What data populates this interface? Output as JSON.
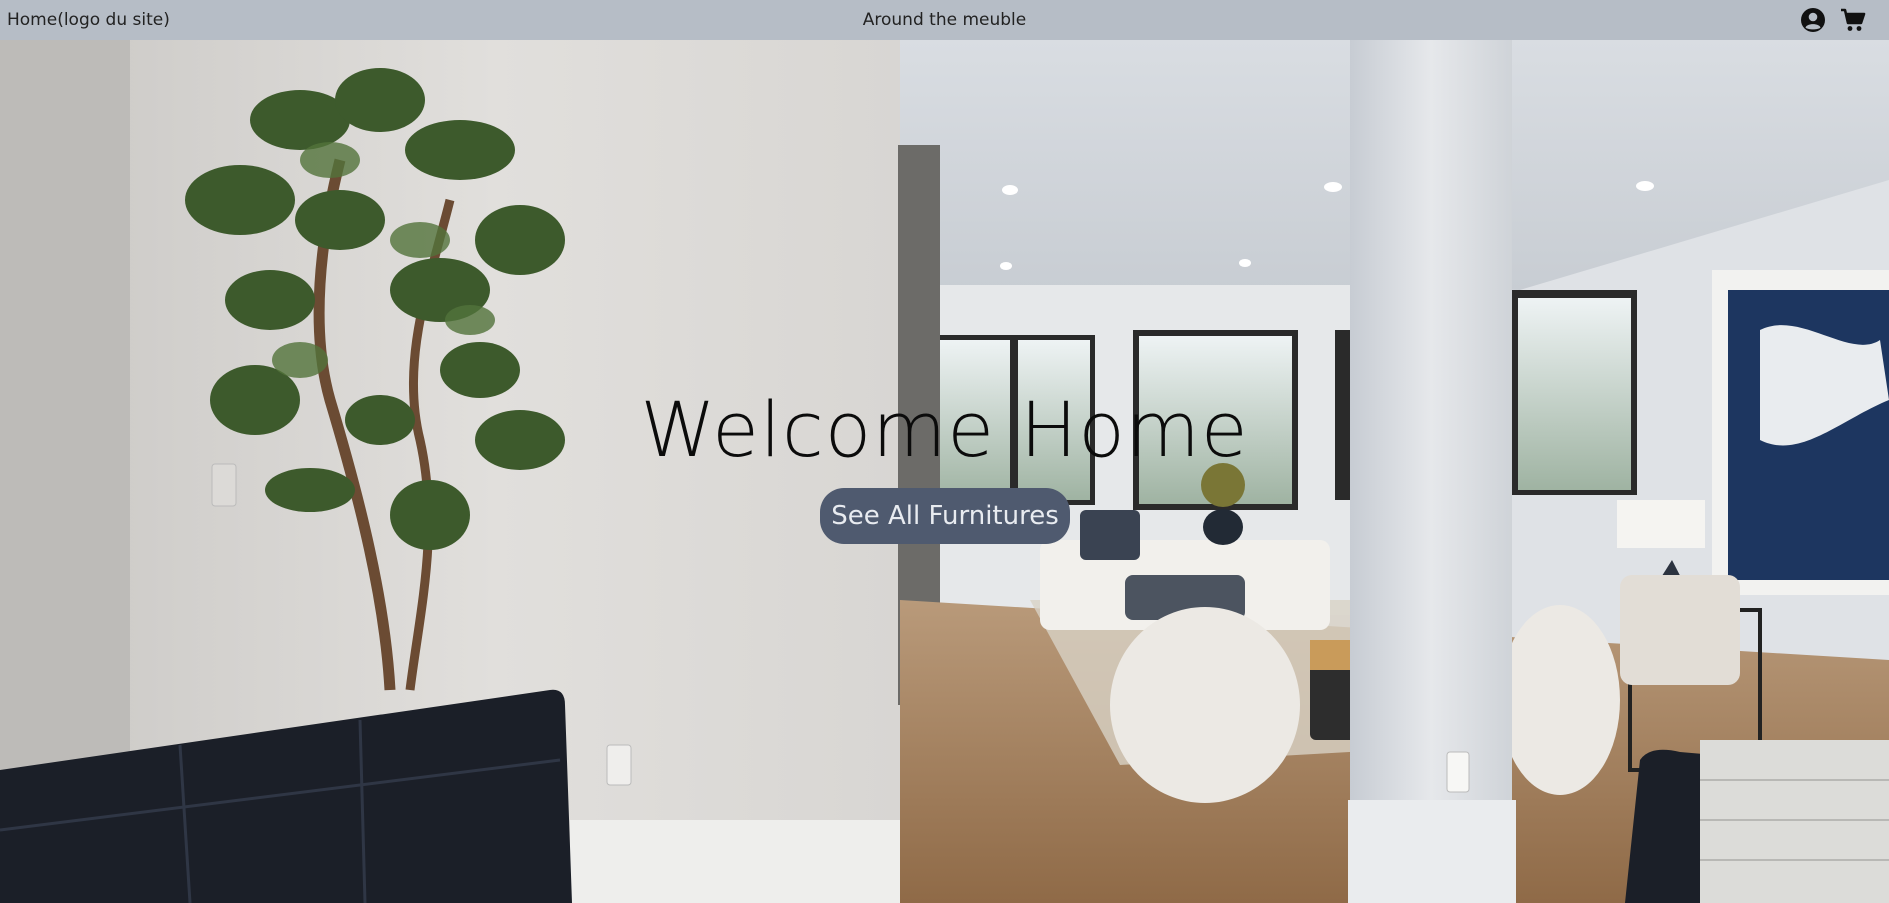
{
  "header": {
    "logo_text": "Home(logo du site)",
    "site_title": "Around the meuble",
    "icons": [
      "account-icon",
      "cart-icon"
    ]
  },
  "hero": {
    "title": "Welcome Home",
    "cta_label": "See All Furnitures",
    "background_description": "interior-living-room-photo"
  },
  "colors": {
    "header_bg": "#b6bdc6",
    "cta_bg": "#4f5a6f",
    "cta_text": "#e8ebf0",
    "title_text": "#0b0b0b"
  }
}
